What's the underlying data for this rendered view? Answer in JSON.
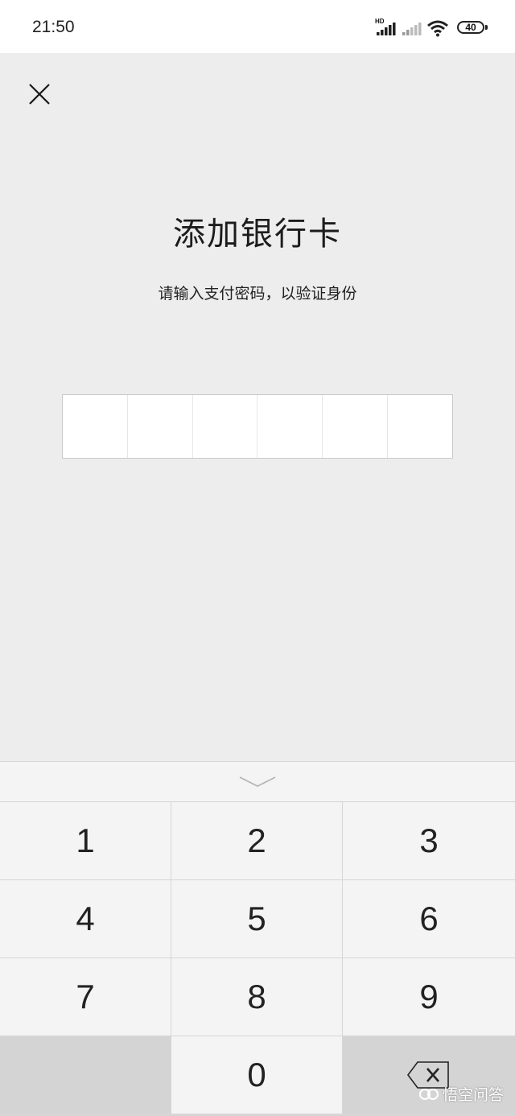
{
  "status_bar": {
    "time": "21:50",
    "network_label": "HD",
    "battery": "40"
  },
  "page": {
    "title": "添加银行卡",
    "subtitle": "请输入支付密码，以验证身份",
    "password_cells": 6
  },
  "keyboard": {
    "keys": [
      "1",
      "2",
      "3",
      "4",
      "5",
      "6",
      "7",
      "8",
      "9",
      "",
      "0",
      "⌫"
    ]
  },
  "watermark": {
    "text": "悟空问答"
  },
  "icons": {
    "close": "close-icon",
    "collapse": "chevron-down-icon",
    "backspace": "backspace-icon"
  }
}
